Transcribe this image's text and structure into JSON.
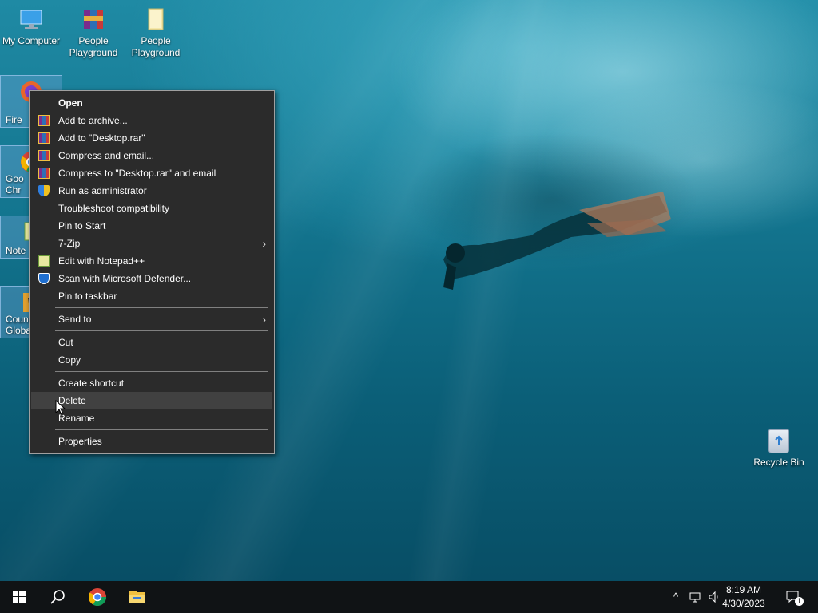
{
  "desktop": {
    "icons": [
      {
        "label": "My Computer"
      },
      {
        "label": "People Playground"
      },
      {
        "label": "People Playground"
      }
    ],
    "partial_icons": [
      {
        "label": "Fire"
      },
      {
        "label": "Goo Chr"
      },
      {
        "label": "Note"
      },
      {
        "label": "Count Globa"
      }
    ],
    "recycle_bin": {
      "label": "Recycle Bin"
    }
  },
  "context_menu": {
    "items": [
      {
        "label": "Open",
        "icon": "none"
      },
      {
        "label": "Add to archive...",
        "icon": "winrar-icon"
      },
      {
        "label": "Add to \"Desktop.rar\"",
        "icon": "winrar-icon"
      },
      {
        "label": "Compress and email...",
        "icon": "winrar-icon"
      },
      {
        "label": "Compress to \"Desktop.rar\" and email",
        "icon": "winrar-icon"
      },
      {
        "label": "Run as administrator",
        "icon": "uac-shield-icon"
      },
      {
        "label": "Troubleshoot compatibility",
        "icon": "none"
      },
      {
        "label": "Pin to Start",
        "icon": "none"
      },
      {
        "label": "7-Zip",
        "icon": "none"
      },
      {
        "label": "Edit with Notepad++",
        "icon": "notepad-plus-plus-icon"
      },
      {
        "label": "Scan with Microsoft Defender...",
        "icon": "defender-icon"
      },
      {
        "label": "Pin to taskbar",
        "icon": "none"
      },
      {
        "label": "Send to",
        "icon": "none"
      },
      {
        "label": "Cut",
        "icon": "none"
      },
      {
        "label": "Copy",
        "icon": "none"
      },
      {
        "label": "Create shortcut",
        "icon": "none"
      },
      {
        "label": "Delete",
        "icon": "none"
      },
      {
        "label": "Rename",
        "icon": "none"
      },
      {
        "label": "Properties",
        "icon": "none"
      }
    ],
    "submenu_arrow": "›"
  },
  "taskbar": {
    "time": "8:19 AM",
    "date": "4/30/2023",
    "notification_count": "1",
    "tray_chevron": "^"
  },
  "colors": {
    "menu_bg": "#2b2b2b",
    "menu_hover": "#414141",
    "taskbar_bg": "#101315"
  }
}
